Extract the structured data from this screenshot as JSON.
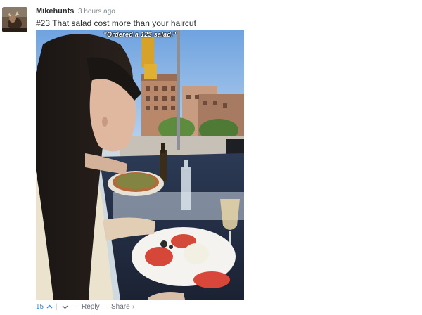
{
  "comment": {
    "author": "Mikehunts",
    "separator": "·",
    "time": "3 hours ago",
    "text": "#23 That salad cost more than your haircut",
    "image_caption": "\"Ordered a 12$ salad.\""
  },
  "footer": {
    "votes": "15",
    "up_icon": "chevron-up-icon",
    "vote_divider": "|",
    "down_icon": "chevron-down-icon",
    "separator": "·",
    "reply_label": "Reply",
    "share_label": "Share",
    "share_chevron": "›"
  },
  "colors": {
    "author": "#2a2e2e",
    "meta": "#7f8a92",
    "vote_accent": "#3d8ccf"
  }
}
